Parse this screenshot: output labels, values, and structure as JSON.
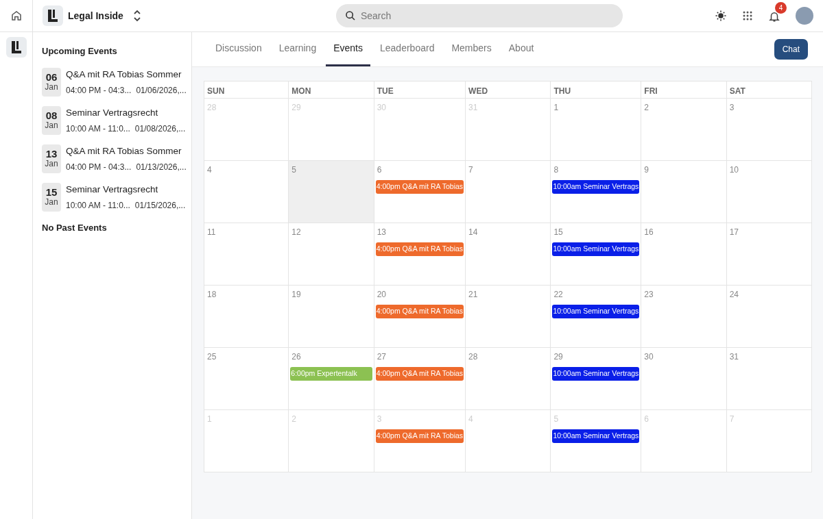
{
  "topbar": {
    "community": "Legal Inside",
    "search": {
      "placeholder": "Search"
    },
    "notifications": "4"
  },
  "sidebar": {
    "upcoming_title": "Upcoming Events",
    "events": [
      {
        "day": "06",
        "month": "Jan",
        "title": "Q&A mit RA Tobias Sommer",
        "time": "04:00 PM - 04:3...",
        "date": "01/06/2026,..."
      },
      {
        "day": "08",
        "month": "Jan",
        "title": "Seminar Vertragsrecht",
        "time": "10:00 AM - 11:0...",
        "date": "01/08/2026,..."
      },
      {
        "day": "13",
        "month": "Jan",
        "title": "Q&A mit RA Tobias Sommer",
        "time": "04:00 PM - 04:3...",
        "date": "01/13/2026,..."
      },
      {
        "day": "15",
        "month": "Jan",
        "title": "Seminar Vertragsrecht",
        "time": "10:00 AM - 11:0...",
        "date": "01/15/2026,..."
      }
    ],
    "past_title": "No Past Events"
  },
  "tabs": [
    {
      "label": "Discussion",
      "selected": false
    },
    {
      "label": "Learning",
      "selected": false
    },
    {
      "label": "Events",
      "selected": true
    },
    {
      "label": "Leaderboard",
      "selected": false
    },
    {
      "label": "Members",
      "selected": false
    },
    {
      "label": "About",
      "selected": false
    }
  ],
  "chat_button": "Chat",
  "calendar": {
    "weekdays": [
      "SUN",
      "MON",
      "TUE",
      "WED",
      "THU",
      "FRI",
      "SAT"
    ],
    "weeks": [
      [
        {
          "day": "28",
          "muted": true
        },
        {
          "day": "29",
          "muted": true
        },
        {
          "day": "30",
          "muted": true
        },
        {
          "day": "31",
          "muted": true
        },
        {
          "day": "1"
        },
        {
          "day": "2"
        },
        {
          "day": "3"
        }
      ],
      [
        {
          "day": "4"
        },
        {
          "day": "5",
          "today": true
        },
        {
          "day": "6",
          "events": [
            {
              "label": "4:00pm Q&A mit RA Tobias",
              "color": "#ee6a2c"
            }
          ]
        },
        {
          "day": "7"
        },
        {
          "day": "8",
          "events": [
            {
              "label": "10:00am Seminar Vertrags",
              "color": "#0a1fe8"
            }
          ]
        },
        {
          "day": "9"
        },
        {
          "day": "10"
        }
      ],
      [
        {
          "day": "11"
        },
        {
          "day": "12"
        },
        {
          "day": "13",
          "events": [
            {
              "label": "4:00pm Q&A mit RA Tobias",
              "color": "#ee6a2c"
            }
          ]
        },
        {
          "day": "14"
        },
        {
          "day": "15",
          "events": [
            {
              "label": "10:00am Seminar Vertrags",
              "color": "#0a1fe8"
            }
          ]
        },
        {
          "day": "16"
        },
        {
          "day": "17"
        }
      ],
      [
        {
          "day": "18"
        },
        {
          "day": "19"
        },
        {
          "day": "20",
          "events": [
            {
              "label": "4:00pm Q&A mit RA Tobias",
              "color": "#ee6a2c"
            }
          ]
        },
        {
          "day": "21"
        },
        {
          "day": "22",
          "events": [
            {
              "label": "10:00am Seminar Vertrags",
              "color": "#0a1fe8"
            }
          ]
        },
        {
          "day": "23"
        },
        {
          "day": "24"
        }
      ],
      [
        {
          "day": "25"
        },
        {
          "day": "26",
          "events": [
            {
              "label": "6:00pm Expertentalk",
              "color": "#8cc152"
            }
          ]
        },
        {
          "day": "27",
          "events": [
            {
              "label": "4:00pm Q&A mit RA Tobias",
              "color": "#ee6a2c"
            }
          ]
        },
        {
          "day": "28"
        },
        {
          "day": "29",
          "events": [
            {
              "label": "10:00am Seminar Vertrags",
              "color": "#0a1fe8"
            }
          ]
        },
        {
          "day": "30"
        },
        {
          "day": "31"
        }
      ],
      [
        {
          "day": "1",
          "muted": true
        },
        {
          "day": "2",
          "muted": true
        },
        {
          "day": "3",
          "muted": true,
          "events": [
            {
              "label": "4:00pm Q&A mit RA Tobias",
              "color": "#ee6a2c"
            }
          ]
        },
        {
          "day": "4",
          "muted": true
        },
        {
          "day": "5",
          "muted": true,
          "events": [
            {
              "label": "10:00am Seminar Vertrags",
              "color": "#0a1fe8"
            }
          ]
        },
        {
          "day": "6",
          "muted": true
        },
        {
          "day": "7",
          "muted": true
        }
      ]
    ]
  }
}
